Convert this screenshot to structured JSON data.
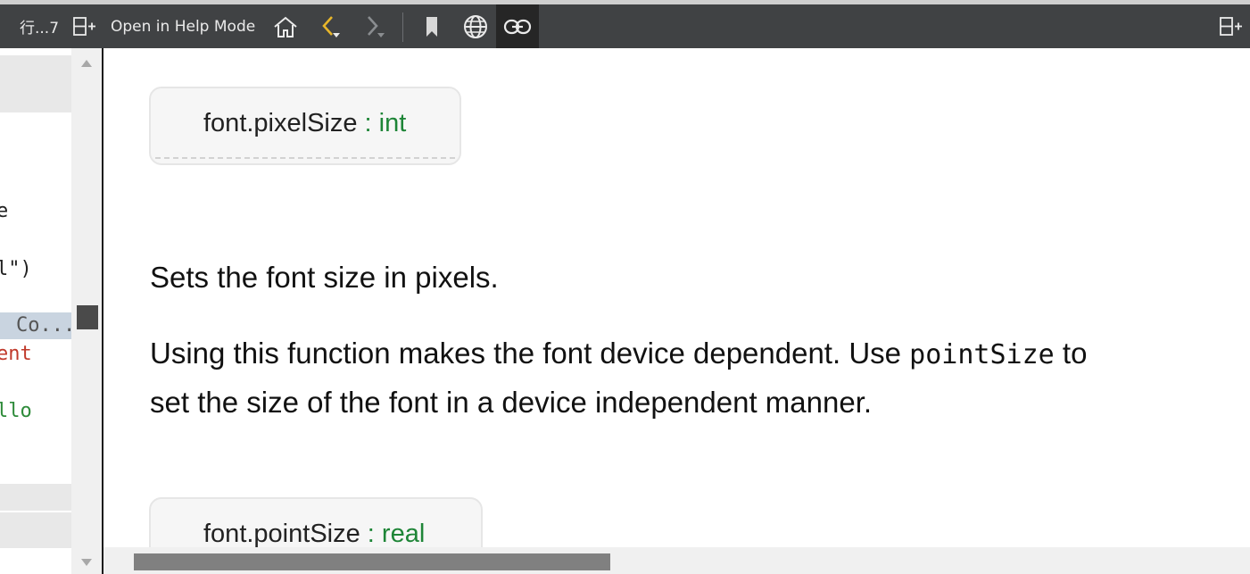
{
  "toolbar": {
    "tab_label": "行...7",
    "split_icon": "split-add-icon",
    "help_mode_label": "Open in Help Mode",
    "home_icon": "home-icon",
    "back_icon": "back-chevron-icon",
    "forward_icon": "forward-chevron-icon",
    "bookmark_icon": "bookmark-icon",
    "globe_icon": "globe-icon",
    "link_icon": "link-icon",
    "accent_color": "#e8b62a"
  },
  "editor": {
    "lines": [
      {
        "text": "e",
        "color": "#222222"
      },
      {
        "text": "l\")",
        "color": "#222222"
      },
      {
        "text": "Co...",
        "color": "#555555"
      },
      {
        "text": "ent",
        "color": "#c0392b"
      },
      {
        "text": "llo",
        "color": "#2e8b3a"
      }
    ]
  },
  "doc": {
    "prop1": {
      "name": "font.pixelSize",
      "sep": " : ",
      "type": "int"
    },
    "desc1": "Sets the font size in pixels.",
    "desc2_pre": "Using this function makes the font device dependent. Use ",
    "desc2_code": "pointSize",
    "desc2_post": " to",
    "desc2_line2": "set the size of the font in a device independent manner.",
    "prop2": {
      "name": "font.pointSize",
      "sep": " : ",
      "type": "real"
    }
  }
}
